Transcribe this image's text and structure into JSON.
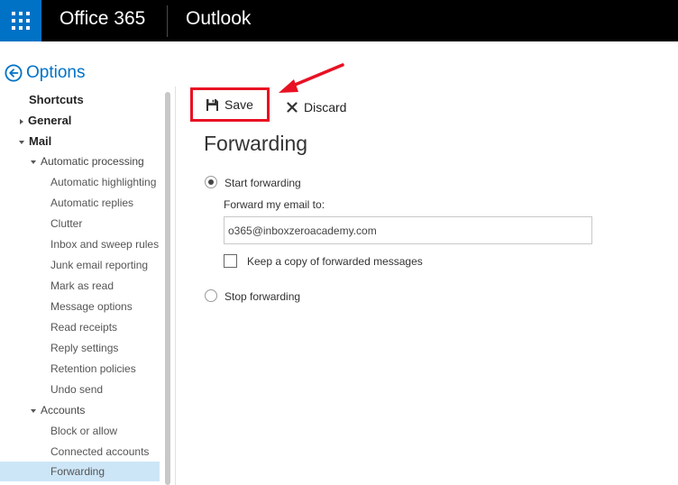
{
  "header": {
    "brand": "Office 365",
    "app_name": "Outlook"
  },
  "options": {
    "title": "Options"
  },
  "nav": {
    "items": [
      {
        "label": "Shortcuts"
      },
      {
        "label": "General"
      },
      {
        "label": "Mail"
      },
      {
        "label": "Automatic processing"
      },
      {
        "label": "Automatic highlighting"
      },
      {
        "label": "Automatic replies"
      },
      {
        "label": "Clutter"
      },
      {
        "label": "Inbox and sweep rules"
      },
      {
        "label": "Junk email reporting"
      },
      {
        "label": "Mark as read"
      },
      {
        "label": "Message options"
      },
      {
        "label": "Read receipts"
      },
      {
        "label": "Reply settings"
      },
      {
        "label": "Retention policies"
      },
      {
        "label": "Undo send"
      },
      {
        "label": "Accounts"
      },
      {
        "label": "Block or allow"
      },
      {
        "label": "Connected accounts"
      },
      {
        "label": "Forwarding"
      }
    ],
    "selected": "Forwarding"
  },
  "toolbar": {
    "save_label": "Save",
    "discard_label": "Discard"
  },
  "forwarding": {
    "title": "Forwarding",
    "start_label": "Start forwarding",
    "start_selected": true,
    "forward_to_label": "Forward my email to:",
    "email_value": "o365@inboxzeroacademy.com",
    "keep_copy_label": "Keep a copy of forwarded messages",
    "keep_copy_checked": false,
    "stop_label": "Stop forwarding"
  },
  "colors": {
    "accent": "#0072c6",
    "annotation": "#e81123",
    "selected_bg": "#cde6f7"
  }
}
